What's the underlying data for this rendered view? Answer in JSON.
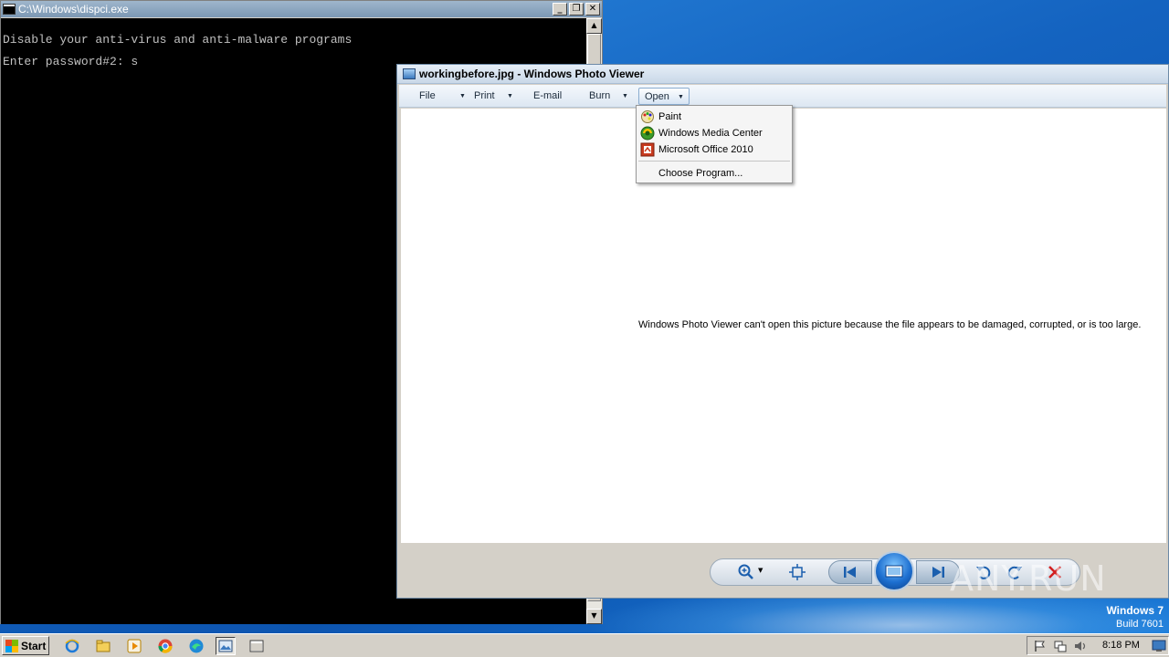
{
  "console": {
    "title": "C:\\Windows\\dispci.exe",
    "lines": [
      "Disable your anti-virus and anti-malware programs",
      "Enter password#2: s"
    ],
    "buttons": {
      "minimize": "_",
      "restore": "❐",
      "close": "✕"
    }
  },
  "photo_viewer": {
    "title": "workingbefore.jpg - Windows Photo Viewer",
    "menu": [
      {
        "label": "File",
        "has_caret": true
      },
      {
        "label": "Print",
        "has_caret": true
      },
      {
        "label": "E-mail",
        "has_caret": false
      },
      {
        "label": "Burn",
        "has_caret": true
      },
      {
        "label": "Open",
        "has_caret": true,
        "open": true
      }
    ],
    "error_message": "Windows Photo Viewer can't open this picture because the file appears to be damaged, corrupted, or is too large.",
    "controls": [
      "zoom-icon",
      "fit-window-icon",
      "previous-icon",
      "slideshow-icon",
      "next-icon",
      "rotate-counterclockwise-icon",
      "rotate-clockwise-icon",
      "delete-icon"
    ]
  },
  "open_menu": {
    "items": [
      {
        "label": "Paint",
        "icon": "paint-icon"
      },
      {
        "label": "Windows Media Center",
        "icon": "media-center-icon"
      },
      {
        "label": "Microsoft Office 2010",
        "icon": "office-icon"
      }
    ],
    "choose_program": "Choose Program..."
  },
  "desktop": {
    "brand_line1": "Windows 7",
    "brand_line2": "Build 7601",
    "watermark": "ANY.RUN"
  },
  "taskbar": {
    "start_label": "Start",
    "pinned": [
      "ie-icon",
      "explorer-icon",
      "media-player-icon",
      "chrome-icon",
      "edge-icon",
      "photo-viewer-icon",
      "console-icon"
    ],
    "clock": "8:18 PM"
  },
  "colors": {
    "desktop_blue": "#1463c0",
    "console_bg": "#000000",
    "console_text": "#c0c0c0",
    "delete_red": "#d21f1f"
  }
}
